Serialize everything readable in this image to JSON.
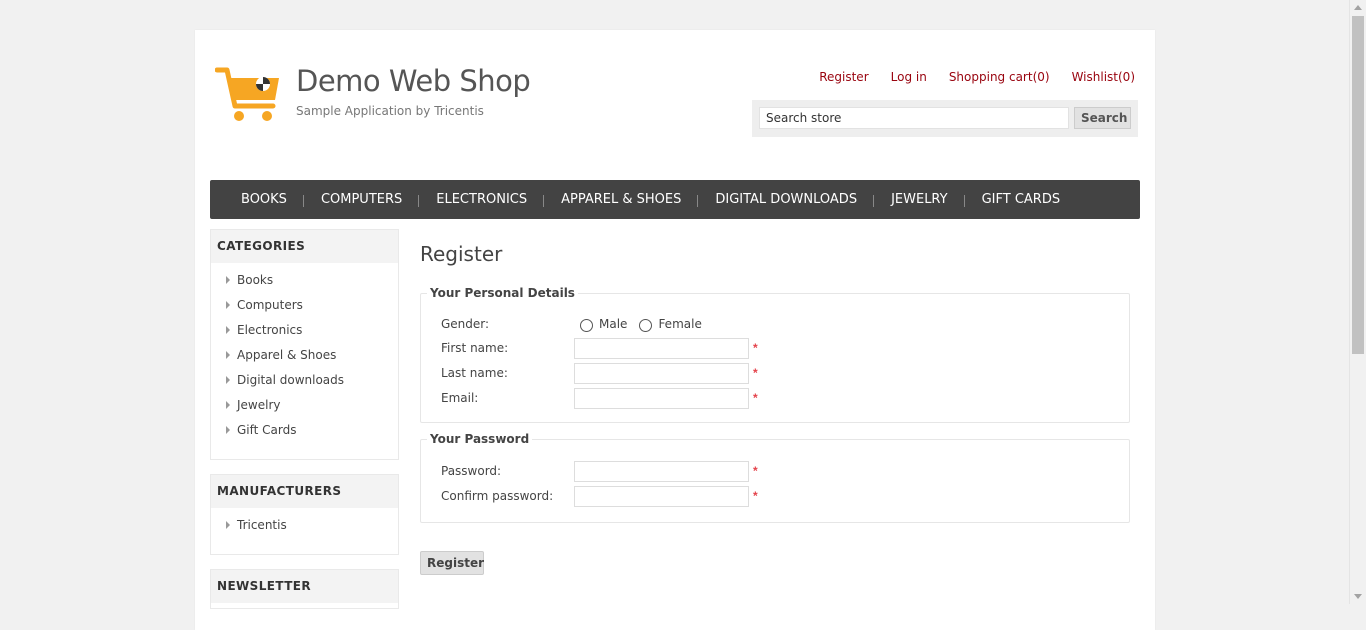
{
  "site": {
    "title": "Demo Web Shop",
    "subtitle": "Sample Application by Tricentis"
  },
  "header_links": [
    "Register",
    "Log in",
    "Shopping cart(0)",
    "Wishlist(0)"
  ],
  "search": {
    "value": "Search store",
    "button": "Search"
  },
  "top_menu": [
    "BOOKS",
    "COMPUTERS",
    "ELECTRONICS",
    "APPAREL & SHOES",
    "DIGITAL DOWNLOADS",
    "JEWELRY",
    "GIFT CARDS"
  ],
  "sidebar": {
    "categories": {
      "title": "CATEGORIES",
      "items": [
        "Books",
        "Computers",
        "Electronics",
        "Apparel & Shoes",
        "Digital downloads",
        "Jewelry",
        "Gift Cards"
      ]
    },
    "manufacturers": {
      "title": "MANUFACTURERS",
      "items": [
        "Tricentis"
      ]
    },
    "newsletter": {
      "title": "NEWSLETTER"
    }
  },
  "register": {
    "title": "Register",
    "personal": {
      "legend": "Your Personal Details",
      "gender_label": "Gender:",
      "male": "Male",
      "female": "Female",
      "first_name": "First name:",
      "last_name": "Last name:",
      "email": "Email:"
    },
    "password": {
      "legend": "Your Password",
      "password": "Password:",
      "confirm": "Confirm password:"
    },
    "required_mark": "*",
    "button": "Register"
  },
  "colors": {
    "link": "#99040f",
    "menu_bg": "#434343",
    "logo": "#f6a623",
    "required": "#e4434b"
  }
}
